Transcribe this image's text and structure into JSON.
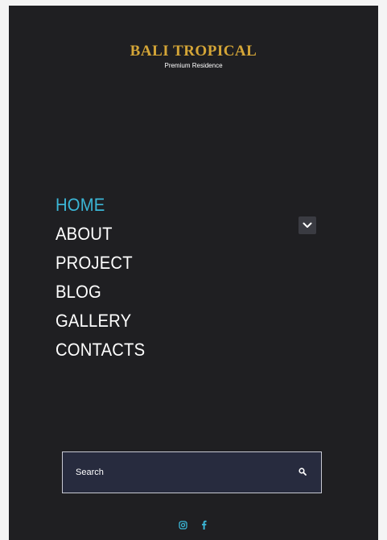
{
  "brand": {
    "title": "BALI TROPICAL",
    "subtitle": "Premium Residence",
    "title_color": "#d4a537"
  },
  "menu": {
    "active_color": "#3bb6d6",
    "items": [
      {
        "label": "HOME",
        "active": true
      },
      {
        "label": "ABOUT",
        "active": false
      },
      {
        "label": "PROJECT",
        "active": false
      },
      {
        "label": "BLOG",
        "active": false
      },
      {
        "label": "GALLERY",
        "active": false
      },
      {
        "label": "CONTACTS",
        "active": false
      }
    ],
    "submenu_icon": "chevron-down-icon"
  },
  "search": {
    "placeholder": "Search",
    "icon": "search-icon"
  },
  "social": {
    "icons": [
      "instagram-icon",
      "facebook-icon"
    ],
    "color": "#3bb6d6"
  }
}
